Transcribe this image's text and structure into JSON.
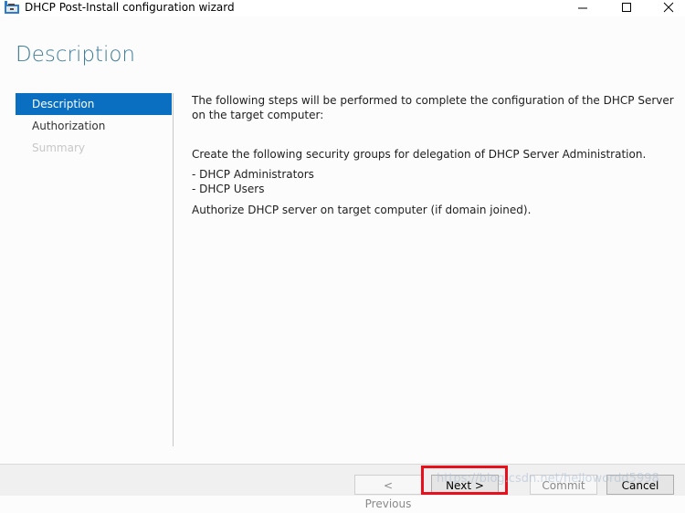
{
  "window": {
    "title": "DHCP Post-Install configuration wizard",
    "controls": {
      "minimize": "minimize",
      "maximize": "maximize",
      "close": "close"
    }
  },
  "page": {
    "heading": "Description"
  },
  "nav": {
    "items": [
      {
        "label": "Description",
        "state": "active"
      },
      {
        "label": "Authorization",
        "state": "enabled"
      },
      {
        "label": "Summary",
        "state": "disabled"
      }
    ]
  },
  "content": {
    "intro": "The following steps will be performed to complete the configuration of the DHCP Server on the target computer:",
    "groups_intro": "Create the following security groups for delegation of DHCP Server Administration.",
    "groups": [
      "- DHCP Administrators",
      "- DHCP Users"
    ],
    "authorize": "Authorize DHCP server on target computer (if domain joined)."
  },
  "buttons": {
    "previous": "< Previous",
    "next": "Next >",
    "commit": "Commit",
    "cancel": "Cancel"
  },
  "overlay": {
    "watermark": "https://blog.csdn.net/hellowordd5998",
    "highlight_color": "#e8101d"
  }
}
